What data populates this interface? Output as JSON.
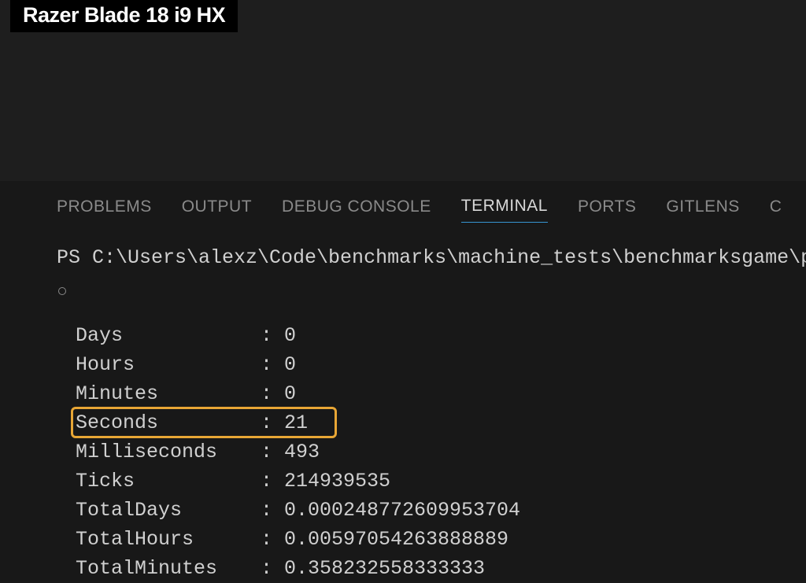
{
  "overlay": {
    "title": "Razer Blade 18 i9 HX"
  },
  "panel": {
    "tabs": {
      "problems": "PROBLEMS",
      "output": "OUTPUT",
      "debug": "DEBUG CONSOLE",
      "terminal": "TERMINAL",
      "ports": "PORTS",
      "gitlens": "GITLENS",
      "extra": "C"
    }
  },
  "terminal": {
    "prompt": "PS C:\\Users\\alexz\\Code\\benchmarks\\machine_tests\\benchmarksgame\\p",
    "results": {
      "days": {
        "label": "Days",
        "value": "0"
      },
      "hours": {
        "label": "Hours",
        "value": "0"
      },
      "minutes": {
        "label": "Minutes",
        "value": "0"
      },
      "seconds": {
        "label": "Seconds",
        "value": "21"
      },
      "milliseconds": {
        "label": "Milliseconds",
        "value": "493"
      },
      "ticks": {
        "label": "Ticks",
        "value": "214939535"
      },
      "totalDays": {
        "label": "TotalDays",
        "value": "0.000248772609953704"
      },
      "totalHours": {
        "label": "TotalHours",
        "value": "0.00597054263888889"
      },
      "totalMinutes": {
        "label": "TotalMinutes",
        "value": "0.358232558333333"
      }
    },
    "colon": ":"
  }
}
